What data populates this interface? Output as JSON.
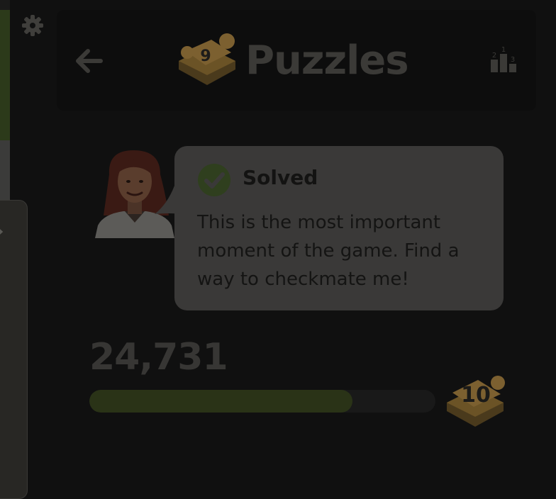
{
  "header": {
    "title": "Puzzles",
    "puzzle_count": "9",
    "back_icon": "arrow-left-icon",
    "leaderboard_icon": "leaderboard-podium-icon",
    "leaderboard_ranks": [
      "2",
      "1",
      "3"
    ]
  },
  "settings": {
    "icon": "gear-icon"
  },
  "coach": {
    "avatar": "coach-avatar",
    "status_icon": "check-circle-icon",
    "status": "Solved",
    "message": "This is the most important moment of the game. Find a way to checkmate me!"
  },
  "progress": {
    "rating": "24,731",
    "fill_fraction": 0.76,
    "next_level": "10"
  },
  "colors": {
    "background": "#101010",
    "bubble": "#3a3938",
    "progress_fill": "#2a3317",
    "check": "#2f3f1e",
    "puzzle_piece": "#8a6a30"
  }
}
